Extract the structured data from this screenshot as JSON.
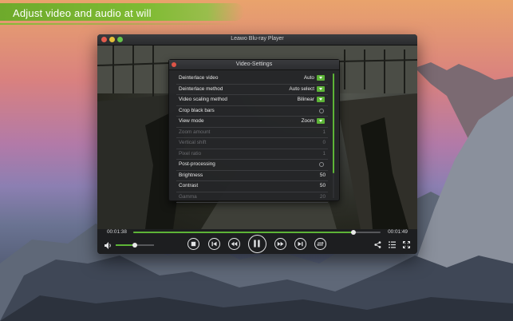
{
  "banner": {
    "text": "Adjust video and audio at will"
  },
  "window": {
    "title": "Leawo Blu-ray Player"
  },
  "settings": {
    "title": "Video-Settings",
    "rows": [
      {
        "label": "Deinterlace video",
        "value": "Auto",
        "control": "dropdown",
        "enabled": true
      },
      {
        "label": "Deinterlace method",
        "value": "Auto select",
        "control": "dropdown",
        "enabled": true
      },
      {
        "label": "Video scaling method",
        "value": "Bilinear",
        "control": "dropdown",
        "enabled": true
      },
      {
        "label": "Crop black bars",
        "value": "",
        "control": "radio",
        "enabled": true
      },
      {
        "label": "View mode",
        "value": "Zoom",
        "control": "dropdown",
        "enabled": true
      },
      {
        "label": "Zoom amount",
        "value": "1",
        "control": "number",
        "enabled": false
      },
      {
        "label": "Vertical shift",
        "value": "0",
        "control": "number",
        "enabled": false
      },
      {
        "label": "Pixel ratio",
        "value": "1",
        "control": "number",
        "enabled": false
      },
      {
        "label": "Post-processing",
        "value": "",
        "control": "radio",
        "enabled": true
      },
      {
        "label": "Brightness",
        "value": "50",
        "control": "number",
        "enabled": true
      },
      {
        "label": "Contrast",
        "value": "50",
        "control": "number",
        "enabled": true
      },
      {
        "label": "Gamma",
        "value": "20",
        "control": "number",
        "enabled": false
      }
    ]
  },
  "player": {
    "elapsed": "00:01:38",
    "remaining": "00:01:49",
    "progress_fraction": 0.89,
    "volume_fraction": 0.5
  },
  "colors": {
    "accent": "#5db437",
    "banner": "#7fbb33"
  },
  "icons": {
    "volume": "speaker-icon",
    "stop": "stop-icon",
    "prev": "skip-back-icon",
    "rewind": "rewind-icon",
    "pause": "pause-icon",
    "forward": "fast-forward-icon",
    "next": "skip-forward-icon",
    "repeat": "repeat-icon",
    "share": "share-icon",
    "playlist": "playlist-icon",
    "fullscreen": "fullscreen-icon"
  }
}
